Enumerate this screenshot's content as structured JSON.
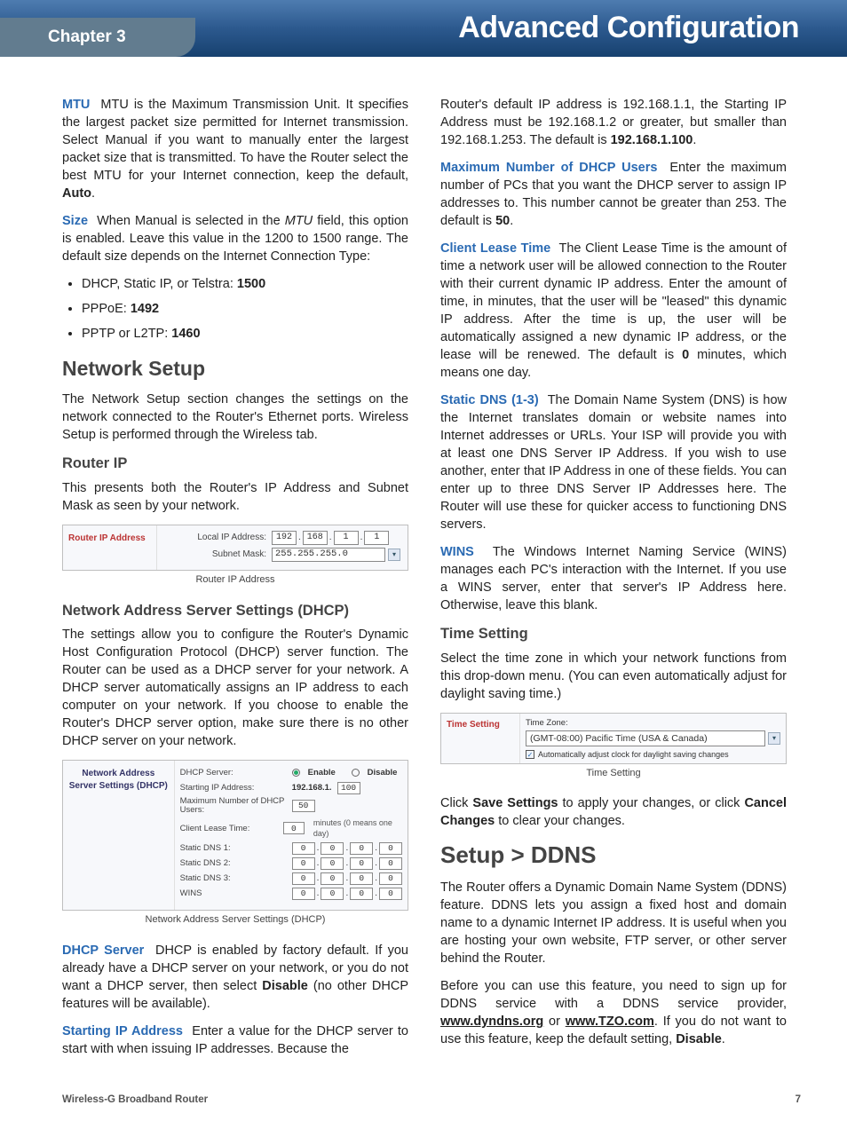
{
  "header": {
    "chapter": "Chapter 3",
    "title": "Advanced Configuration"
  },
  "left": {
    "mtu_term": "MTU",
    "mtu_text_1": "MTU is the Maximum Transmission Unit. It specifies the largest packet size permitted for Internet transmission. Select Manual if you want to manually enter the largest packet size that is transmitted. To have the Router select the best MTU for your Internet connection, keep the default, ",
    "mtu_bold_auto": "Auto",
    "size_term": "Size",
    "size_text_1": "When Manual is selected in the ",
    "size_ital": "MTU",
    "size_text_2": " field, this option is enabled. Leave this value in the 1200 to 1500 range. The default size depends on the Internet Connection Type:",
    "bullets": [
      {
        "t1": "DHCP, Static IP, or Telstra: ",
        "b": "1500"
      },
      {
        "t1": "PPPoE: ",
        "b": "1492"
      },
      {
        "t1": "PPTP or L2TP: ",
        "b": "1460"
      }
    ],
    "netsetup_h": "Network Setup",
    "netsetup_p": "The Network Setup section changes the settings on the network connected to the Router's Ethernet ports. Wireless Setup is performed through the Wireless tab.",
    "routerip_h": "Router IP",
    "routerip_p": "This presents both the Router's IP Address and Subnet Mask as seen by your network.",
    "scr_router": {
      "panel_label": "Router IP Address",
      "row1_label": "Local IP Address:",
      "ip": [
        "192",
        "168",
        "1",
        "1"
      ],
      "row2_label": "Subnet Mask:",
      "mask": "255.255.255.0",
      "caption": "Router IP Address"
    },
    "dhcp_h": "Network Address Server Settings (DHCP)",
    "dhcp_p": "The settings allow you to configure the Router's Dynamic Host Configuration Protocol (DHCP) server function. The Router can be used as a DHCP server for your network. A DHCP server automatically assigns an IP address to each computer on your network. If you choose to enable the Router's DHCP server option, make sure there is no other DHCP server on your network.",
    "scr_dhcp": {
      "panel_label": "Network Address\nServer Settings (DHCP)",
      "rows": {
        "dhcp_server": "DHCP Server:",
        "enable": "Enable",
        "disable": "Disable",
        "starting_ip": "Starting IP Address:",
        "starting_ip_prefix": "192.168.1.",
        "starting_ip_val": "100",
        "max_users": "Maximum Number of DHCP Users:",
        "max_users_val": "50",
        "lease": "Client Lease Time:",
        "lease_val": "0",
        "lease_hint": "minutes (0 means one day)",
        "dns1": "Static DNS 1:",
        "dns2": "Static DNS 2:",
        "dns3": "Static DNS 3:",
        "wins": "WINS",
        "zero_ip": [
          "0",
          "0",
          "0",
          "0"
        ]
      },
      "caption": "Network Address Server Settings (DHCP)"
    },
    "dhcpserver_term": "DHCP Server",
    "dhcpserver_text_1": "DHCP is enabled by factory default. If you already have a DHCP server on your network, or you do not want a DHCP server, then select ",
    "dhcpserver_bold": "Disable",
    "dhcpserver_text_2": " (no other DHCP features will be available).",
    "startip_term": "Starting IP Address",
    "startip_text": "Enter a value for the DHCP server to start with when issuing IP addresses. Because the"
  },
  "right": {
    "cont_text_1": "Router's default IP address is 192.168.1.1, the Starting IP Address must be 192.168.1.2 or greater, but smaller than 192.168.1.253. The default is ",
    "cont_bold": "192.168.1.100",
    "max_term": "Maximum Number of DHCP Users",
    "max_text_1": "Enter the maximum number of PCs that you want the DHCP server to assign IP addresses to. This number cannot be greater than 253. The default is ",
    "max_bold": "50",
    "lease_term": "Client Lease Time",
    "lease_text_1": "The Client Lease Time is the amount of time a network user will be allowed connection to the Router with their current dynamic IP address. Enter the amount of time, in minutes, that the user will be \"leased\" this dynamic IP address. After the time is up, the user will be automatically assigned a new dynamic IP address, or the lease will be renewed. The default is ",
    "lease_bold": "0",
    "lease_text_2": " minutes, which means one day.",
    "dns_term": "Static DNS (1-3)",
    "dns_text": "The Domain Name System (DNS) is how the Internet translates domain or website names into Internet addresses or URLs. Your ISP will provide you with at least one DNS Server IP Address. If you wish to use another, enter that IP Address in one of these fields. You can enter up to three DNS Server IP Addresses here. The Router will use these for quicker access to functioning DNS servers.",
    "wins_term": "WINS",
    "wins_text": "The Windows Internet Naming Service (WINS) manages each PC's interaction with the Internet. If you use a WINS server, enter that server's IP Address here. Otherwise, leave this blank.",
    "time_h": "Time Setting",
    "time_p": "Select the time zone in which your network functions from this drop-down menu. (You can even automatically adjust for daylight saving time.)",
    "scr_time": {
      "panel_label": "Time Setting",
      "tz_label": "Time Zone:",
      "tz_value": "(GMT-08:00) Pacific Time (USA & Canada)",
      "dst": "Automatically adjust clock for daylight saving changes",
      "caption": "Time Setting"
    },
    "save_text_1": "Click ",
    "save_bold1": "Save Settings",
    "save_text_2": " to apply your changes, or click ",
    "save_bold2": "Cancel Changes",
    "save_text_3": " to clear your changes.",
    "ddns_h": "Setup > DDNS",
    "ddns_p1": "The Router offers a Dynamic Domain Name System (DDNS) feature. DDNS lets you assign a fixed host and domain name to a dynamic Internet IP address. It is useful when you are hosting your own website, FTP server, or other server behind the Router.",
    "ddns_p2_1": "Before you can use this feature, you need to sign up for DDNS service with a DDNS service provider, ",
    "ddns_link1": "www.dyndns.org",
    "ddns_or": " or ",
    "ddns_link2": "www.TZO.com",
    "ddns_p2_2": ". If you do not want to use this feature, keep the default setting, ",
    "ddns_bold": "Disable"
  },
  "footer": {
    "prod": "Wireless-G Broadband Router",
    "page": "7"
  }
}
